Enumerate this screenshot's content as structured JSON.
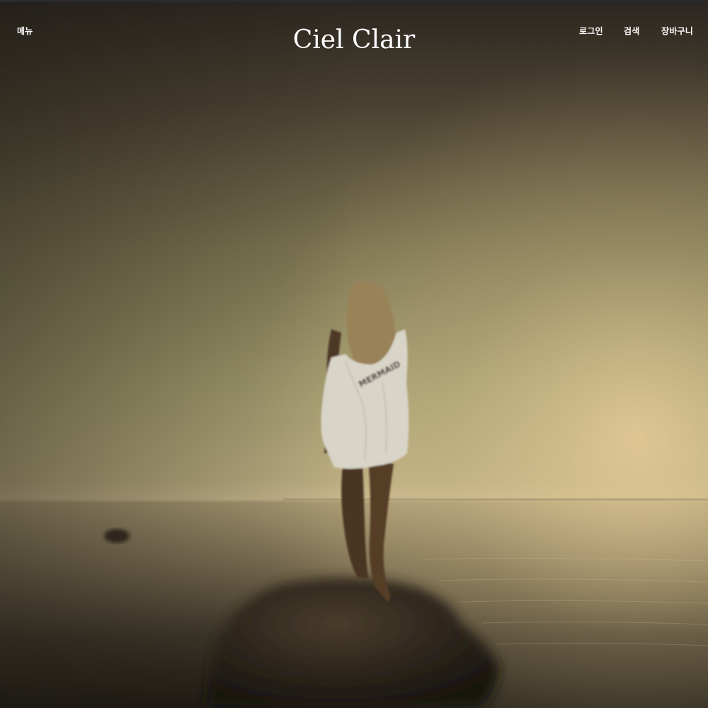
{
  "header": {
    "menu_label": "메뉴",
    "brand_name": "Ciel Clair",
    "login_label": "로그인",
    "search_label": "검색",
    "cart_label": "장바구니"
  },
  "hero": {
    "shirt_text": "MERMAID"
  }
}
